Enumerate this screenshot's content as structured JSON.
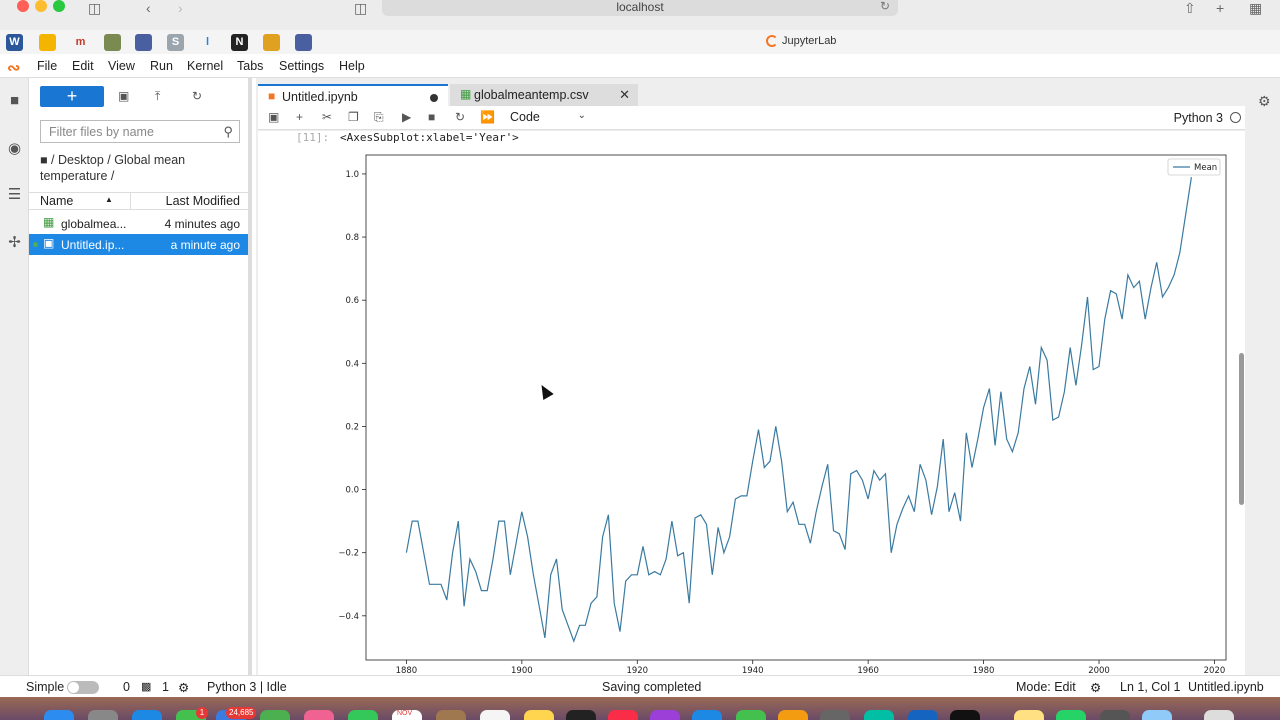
{
  "browser": {
    "url": "localhost",
    "tab_title": "JupyterLab"
  },
  "menu": {
    "items": [
      "File",
      "Edit",
      "View",
      "Run",
      "Kernel",
      "Tabs",
      "Settings",
      "Help"
    ]
  },
  "filebrowser": {
    "new_label": "+",
    "filter_placeholder": "Filter files by name",
    "breadcrumb": "/ Desktop / Global mean temperature /",
    "col_name": "Name",
    "col_modified": "Last Modified",
    "files": [
      {
        "name": "globalmea...",
        "modified": "4 minutes ago",
        "icon": "table-icon",
        "selected": false
      },
      {
        "name": "Untitled.ip...",
        "modified": "a minute ago",
        "icon": "notebook-icon",
        "selected": true
      }
    ]
  },
  "tabs": [
    {
      "label": "Untitled.ipynb",
      "active": true,
      "icon": "notebook-icon"
    },
    {
      "label": "globalmeantemp.csv",
      "active": false,
      "icon": "table-icon"
    }
  ],
  "toolbar": {
    "cell_type": "Code",
    "kernel": "Python 3"
  },
  "cell": {
    "prompt": "[11]:",
    "output_text": "<AxesSubplot:xlabel='Year'>"
  },
  "chart_data": {
    "type": "line",
    "title": "",
    "xlabel": "",
    "ylabel": "",
    "xlim": [
      1873,
      2022
    ],
    "ylim": [
      -0.54,
      1.06
    ],
    "xticks": [
      1880,
      1900,
      1920,
      1940,
      1960,
      1980,
      2000,
      2020
    ],
    "yticks": [
      -0.4,
      -0.2,
      0.0,
      0.2,
      0.4,
      0.6,
      0.8,
      1.0
    ],
    "grid": false,
    "legend_position": "top-right",
    "series": [
      {
        "name": "Mean",
        "color": "#3a7aa0",
        "x": [
          1880,
          1881,
          1882,
          1883,
          1884,
          1885,
          1886,
          1887,
          1888,
          1889,
          1890,
          1891,
          1892,
          1893,
          1894,
          1895,
          1896,
          1897,
          1898,
          1899,
          1900,
          1901,
          1902,
          1903,
          1904,
          1905,
          1906,
          1907,
          1908,
          1909,
          1910,
          1911,
          1912,
          1913,
          1914,
          1915,
          1916,
          1917,
          1918,
          1919,
          1920,
          1921,
          1922,
          1923,
          1924,
          1925,
          1926,
          1927,
          1928,
          1929,
          1930,
          1931,
          1932,
          1933,
          1934,
          1935,
          1936,
          1937,
          1938,
          1939,
          1940,
          1941,
          1942,
          1943,
          1944,
          1945,
          1946,
          1947,
          1948,
          1949,
          1950,
          1951,
          1952,
          1953,
          1954,
          1955,
          1956,
          1957,
          1958,
          1959,
          1960,
          1961,
          1962,
          1963,
          1964,
          1965,
          1966,
          1967,
          1968,
          1969,
          1970,
          1971,
          1972,
          1973,
          1974,
          1975,
          1976,
          1977,
          1978,
          1979,
          1980,
          1981,
          1982,
          1983,
          1984,
          1985,
          1986,
          1987,
          1988,
          1989,
          1990,
          1991,
          1992,
          1993,
          1994,
          1995,
          1996,
          1997,
          1998,
          1999,
          2000,
          2001,
          2002,
          2003,
          2004,
          2005,
          2006,
          2007,
          2008,
          2009,
          2010,
          2011,
          2012,
          2013,
          2014,
          2015,
          2016
        ],
        "values": [
          -0.2,
          -0.1,
          -0.1,
          -0.2,
          -0.3,
          -0.3,
          -0.3,
          -0.35,
          -0.2,
          -0.1,
          -0.37,
          -0.22,
          -0.26,
          -0.32,
          -0.32,
          -0.22,
          -0.1,
          -0.1,
          -0.27,
          -0.17,
          -0.07,
          -0.15,
          -0.27,
          -0.37,
          -0.47,
          -0.27,
          -0.22,
          -0.38,
          -0.43,
          -0.48,
          -0.43,
          -0.43,
          -0.36,
          -0.34,
          -0.15,
          -0.08,
          -0.36,
          -0.45,
          -0.29,
          -0.27,
          -0.27,
          -0.18,
          -0.27,
          -0.26,
          -0.27,
          -0.22,
          -0.1,
          -0.21,
          -0.2,
          -0.36,
          -0.09,
          -0.08,
          -0.11,
          -0.27,
          -0.12,
          -0.2,
          -0.15,
          -0.03,
          -0.02,
          -0.02,
          0.09,
          0.19,
          0.07,
          0.09,
          0.2,
          0.09,
          -0.07,
          -0.04,
          -0.11,
          -0.11,
          -0.17,
          -0.07,
          0.01,
          0.08,
          -0.13,
          -0.14,
          -0.19,
          0.05,
          0.06,
          0.03,
          -0.03,
          0.06,
          0.03,
          0.05,
          -0.2,
          -0.11,
          -0.06,
          -0.02,
          -0.07,
          0.08,
          0.03,
          -0.08,
          0.01,
          0.16,
          -0.07,
          -0.01,
          -0.1,
          0.18,
          0.07,
          0.16,
          0.26,
          0.32,
          0.14,
          0.31,
          0.16,
          0.12,
          0.18,
          0.32,
          0.39,
          0.27,
          0.45,
          0.41,
          0.22,
          0.23,
          0.31,
          0.45,
          0.33,
          0.46,
          0.61,
          0.38,
          0.39,
          0.54,
          0.63,
          0.62,
          0.54,
          0.68,
          0.64,
          0.66,
          0.54,
          0.64,
          0.72,
          0.61,
          0.64,
          0.68,
          0.75,
          0.87,
          0.99
        ]
      }
    ]
  },
  "status": {
    "mode_label": "Simple",
    "terminals": "0",
    "kernels": "1",
    "kernel_status": "Python 3 | Idle",
    "message": "Saving completed",
    "edit_mode": "Mode: Edit",
    "position": "Ln 1, Col 1",
    "filename": "Untitled.ipynb"
  },
  "dock": {
    "badge_mail": "24,685",
    "badge_msg": "1",
    "calendar": "NOV"
  },
  "colors": {
    "accent": "#1976d2",
    "jupyter": "#f37626",
    "line": "#3a7aa0"
  }
}
